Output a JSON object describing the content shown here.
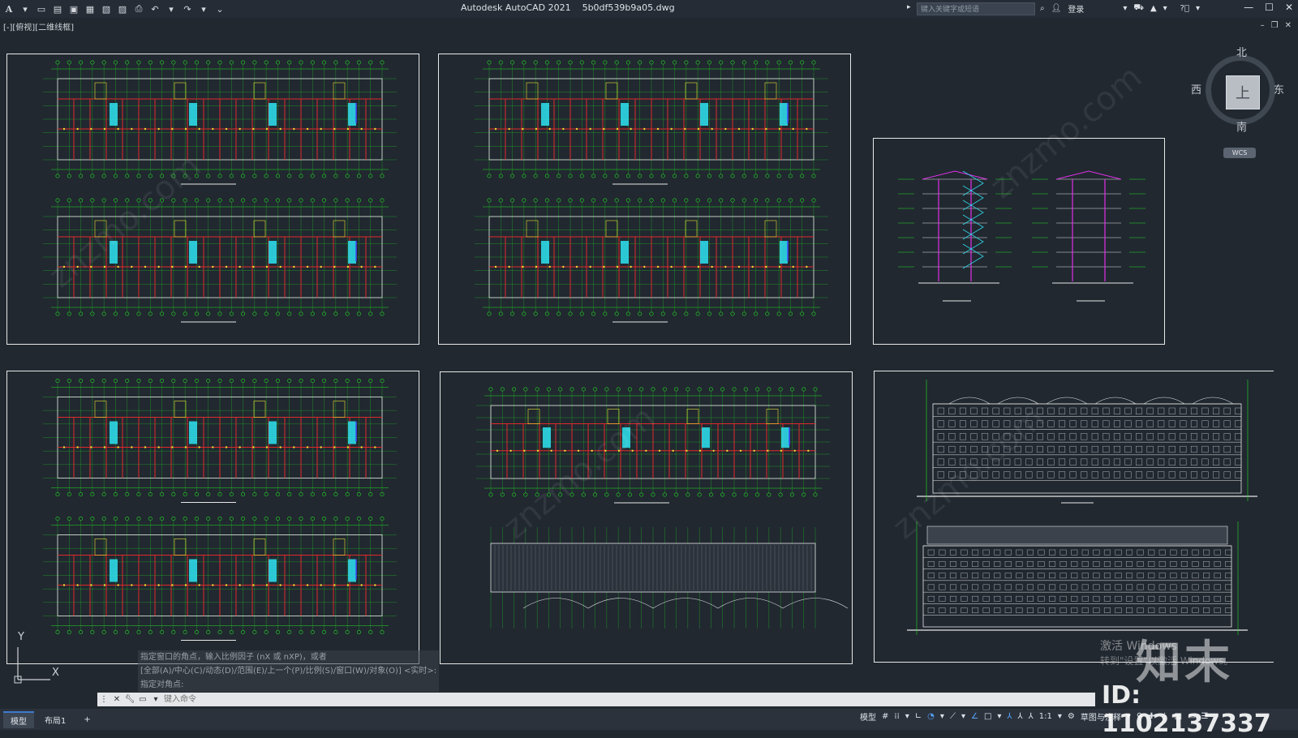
{
  "titlebar": {
    "app_logo": "A",
    "title": "Autodesk AutoCAD 2021    5b0df539b9a05.dwg",
    "search_placeholder": "键入关键字或短语",
    "login_label": "登录",
    "qat_icons": [
      "new-icon",
      "open-icon",
      "save-icon",
      "saveas-icon",
      "plot-preview-icon",
      "publish-icon",
      "print-icon",
      "undo-icon",
      "redo-icon",
      "customize-icon"
    ]
  },
  "viewport": {
    "label": "[-][俯视][二维线框]"
  },
  "viewcube": {
    "top": "上",
    "north": "北",
    "south": "南",
    "east": "东",
    "west": "西",
    "wcs": "WCS"
  },
  "ucs": {
    "x": "X",
    "y": "Y"
  },
  "command": {
    "history": [
      "指定窗口的角点，输入比例因子 (nX 或 nXP)，或者",
      "[全部(A)/中心(C)/动态(D)/范围(E)/上一个(P)/比例(S)/窗口(W)/对象(O)] <实时>:",
      "指定对角点:"
    ],
    "placeholder": "键入命令"
  },
  "status": {
    "tabs": [
      "模型",
      "布局1",
      "+"
    ],
    "model_label": "模型",
    "scale": "1:1",
    "annotation": "草图与注释"
  },
  "watermark": {
    "logo": "知末",
    "id": "ID: 1102137337",
    "activate": "激活 Windows",
    "activate_hint": "转到\"设置\"以激活 Windows。",
    "site": "znzmo.com"
  },
  "colors": {
    "background": "#212830",
    "grid_green": "#22e022",
    "wall_red": "#e02a2a",
    "stair_cyan": "#2ed8e8",
    "magenta": "#e030e8",
    "blue": "#3a4cff",
    "yellow": "#e8e030"
  }
}
